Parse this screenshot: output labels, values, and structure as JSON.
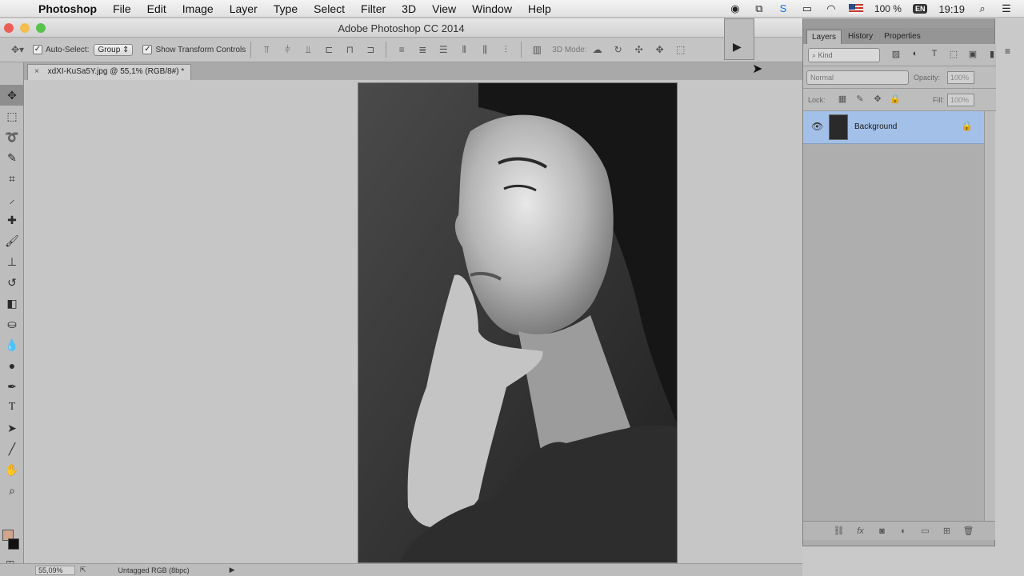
{
  "menubar": {
    "app_name": "Photoshop",
    "items": [
      "File",
      "Edit",
      "Image",
      "Layer",
      "Type",
      "Select",
      "Filter",
      "3D",
      "View",
      "Window",
      "Help"
    ],
    "battery": "100 %",
    "input_source": "EN",
    "clock": "19:19"
  },
  "window": {
    "title": "Adobe Photoshop CC 2014"
  },
  "options": {
    "auto_select_label": "Auto-Select:",
    "auto_select_value": "Group",
    "show_transform_label": "Show Transform Controls",
    "mode_3d_label": "3D Mode:"
  },
  "document": {
    "tab_label": "xdXI-KuSa5Y.jpg @ 55,1% (RGB/8#) *",
    "close_glyph": "×"
  },
  "status": {
    "zoom": "55,09%",
    "profile": "Untagged RGB (8bpc)"
  },
  "layers_panel": {
    "tabs": [
      "Layers",
      "History",
      "Properties"
    ],
    "filter_placeholder": "Kind",
    "blend_mode": "Normal",
    "opacity_label": "Opacity:",
    "opacity_value": "100%",
    "lock_label": "Lock:",
    "fill_label": "Fill:",
    "fill_value": "100%",
    "layer_name": "Background"
  },
  "colors": {
    "accent_selection": "#a3c0e8",
    "foreground_swatch": "#d2a58e",
    "background_swatch": "#111111"
  }
}
